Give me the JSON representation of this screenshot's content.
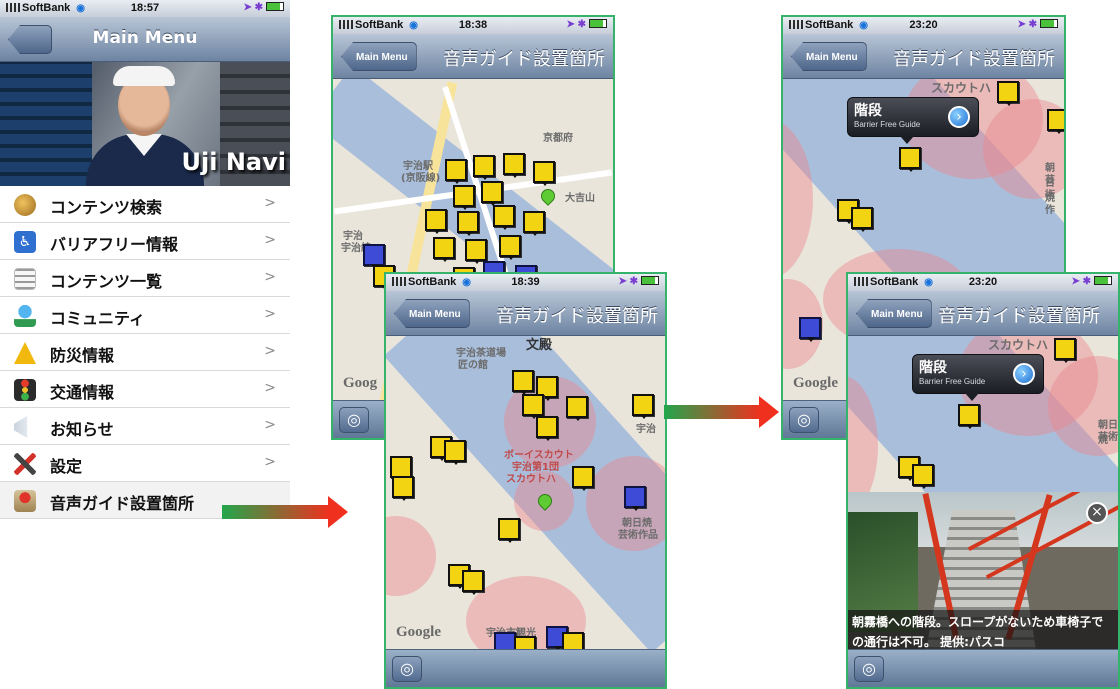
{
  "colors": {
    "accent": "#36b36a",
    "arrow_start": "#22a64b",
    "arrow_end": "#f0301f"
  },
  "screen1": {
    "status": {
      "carrier": "SoftBank",
      "time": "18:57"
    },
    "nav": {
      "title": "Main Menu"
    },
    "hero": {
      "brand": "Uji Navi"
    },
    "menu": [
      {
        "label": "コンテンツ検索",
        "icon": "globe-icon"
      },
      {
        "label": "バリアフリー情報",
        "icon": "wheelchair-icon"
      },
      {
        "label": "コンテンツ一覧",
        "icon": "list-icon"
      },
      {
        "label": "コミュニティ",
        "icon": "community-icon"
      },
      {
        "label": "防災情報",
        "icon": "warning-icon"
      },
      {
        "label": "交通情報",
        "icon": "traffic-light-icon"
      },
      {
        "label": "お知らせ",
        "icon": "megaphone-icon"
      },
      {
        "label": "設定",
        "icon": "tools-icon"
      },
      {
        "label": "音声ガイド設置箇所",
        "icon": "map-pin-icon"
      }
    ]
  },
  "screen2": {
    "status": {
      "carrier": "SoftBank",
      "time": "18:38"
    },
    "nav": {
      "back": "Main Menu",
      "title": "音声ガイド設置箇所"
    },
    "map": {
      "labels": [
        "宇治駅",
        "(京阪線)",
        "宇治",
        "大吉山",
        "京都府",
        "宇治線"
      ]
    }
  },
  "screen3": {
    "status": {
      "carrier": "SoftBank",
      "time": "18:39"
    },
    "nav": {
      "back": "Main Menu",
      "title": "音声ガイド設置箇所"
    },
    "map": {
      "labels": [
        "宇治茶道場",
        "匠の館",
        "ボーイスカウト",
        "宇治第1団",
        "スカウトハ",
        "朝日焼",
        "芸術作品",
        "宇治市観光",
        "文殿",
        "宇治"
      ],
      "google": "Google"
    }
  },
  "screen4": {
    "status": {
      "carrier": "SoftBank",
      "time": "23:20"
    },
    "nav": {
      "back": "Main Menu",
      "title": "音声ガイド設置箇所"
    },
    "callout": {
      "title": "階段",
      "subtitle": "Barrier Free Guide"
    },
    "map": {
      "labels": [
        "スカウトハ",
        "朝日焼",
        "芸術作"
      ],
      "google": "Google"
    }
  },
  "screen5": {
    "status": {
      "carrier": "SoftBank",
      "time": "23:20"
    },
    "nav": {
      "back": "Main Menu",
      "title": "音声ガイド設置箇所"
    },
    "callout": {
      "title": "階段",
      "subtitle": "Barrier Free Guide"
    },
    "map": {
      "labels": [
        "スカウトハ",
        "朝日焼",
        "芸術"
      ]
    },
    "photo": {
      "caption_line1": "朝霧橋への階段。スロープがないため車椅子で",
      "caption_line2": "の通行は不可。 提供:パスコ"
    }
  }
}
